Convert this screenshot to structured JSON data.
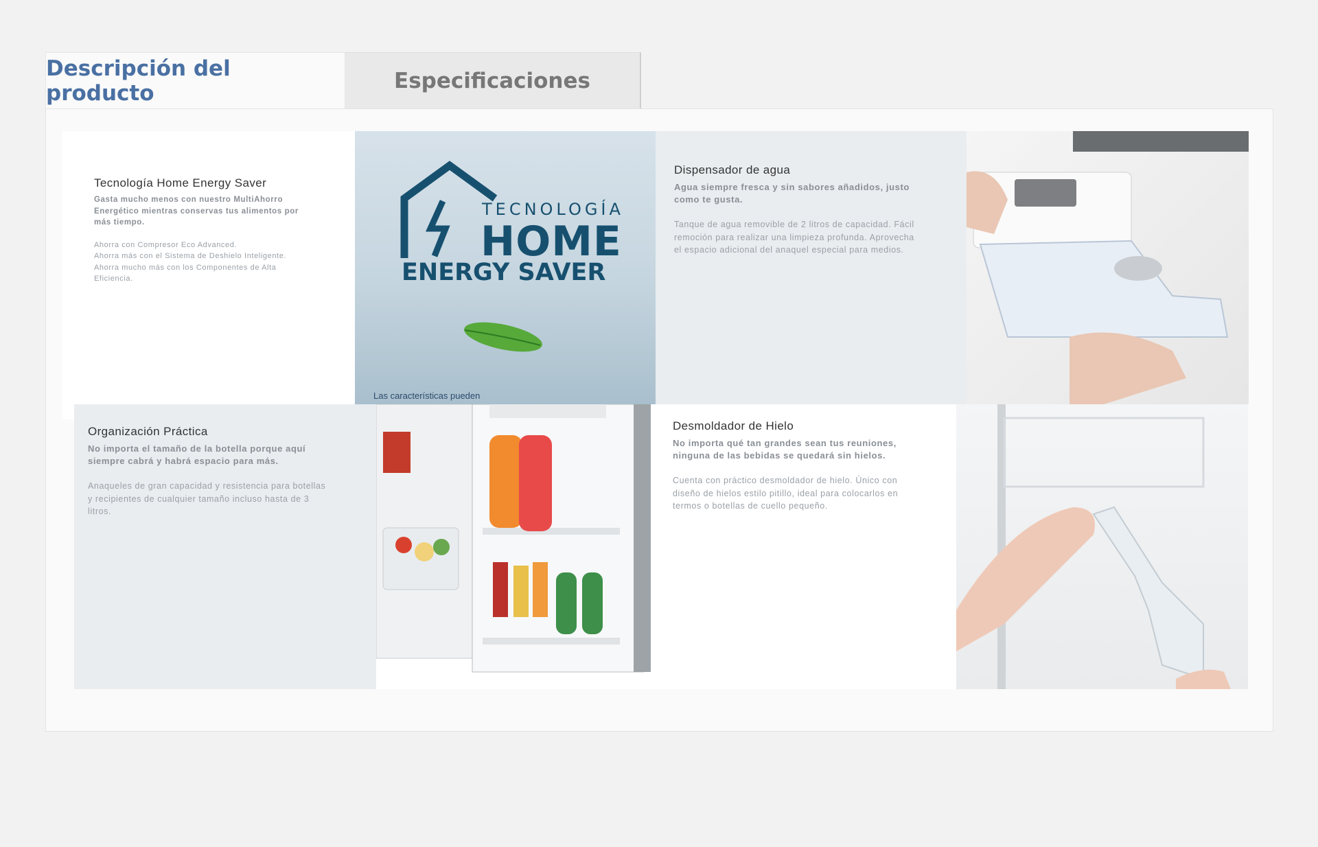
{
  "tabs": {
    "description": "Descripción del producto",
    "specs": "Especificaciones"
  },
  "features": {
    "energy": {
      "title": "Tecnología Home Energy Saver",
      "lead": "Gasta mucho menos con nuestro MultiAhorro Energético mientras conservas tus alimentos por más tiempo.",
      "lines": [
        "Ahorra con Compresor Eco Advanced.",
        "Ahorra más con el Sistema de Deshielo Inteligente.",
        "Ahorra mucho más con los Componentes de Alta Eficiencia."
      ]
    },
    "water": {
      "title": "Dispensador de agua",
      "lead": "Agua siempre fresca y sin sabores añadidos, justo como te gusta.",
      "body": "Tanque de agua removible de 2 litros de capacidad. Fácil remoción para realizar una limpieza profunda.  Aprovecha el espacio adicional del anaquel especial para medios."
    },
    "organization": {
      "title": "Organización Práctica",
      "lead": "No importa el tamaño de la botella porque aquí siempre cabrá y habrá espacio para más.",
      "body": "Anaqueles de gran capacidad y resistencia para botellas y recipientes de cualquier tamaño incluso hasta de 3 litros."
    },
    "ice": {
      "title": "Desmoldador de Hielo",
      "lead": "No importa qué tan grandes sean tus reuniones, ninguna de las bebidas se quedará sin hielos.",
      "body": "Cuenta con práctico desmoldador de hielo. Único con diseño de hielos estilo pitillo, ideal para colocarlos en termos o botellas de cuello pequeño."
    }
  },
  "energy_logo": {
    "line1": "TECNOLOGÍA",
    "line2": "HOME",
    "line3": "ENERGY SAVER",
    "note": "Las características pueden",
    "color": "#17506f"
  },
  "colors": {
    "accent_tab": "#4a70a3",
    "panel_gray": "#e9edf0"
  }
}
